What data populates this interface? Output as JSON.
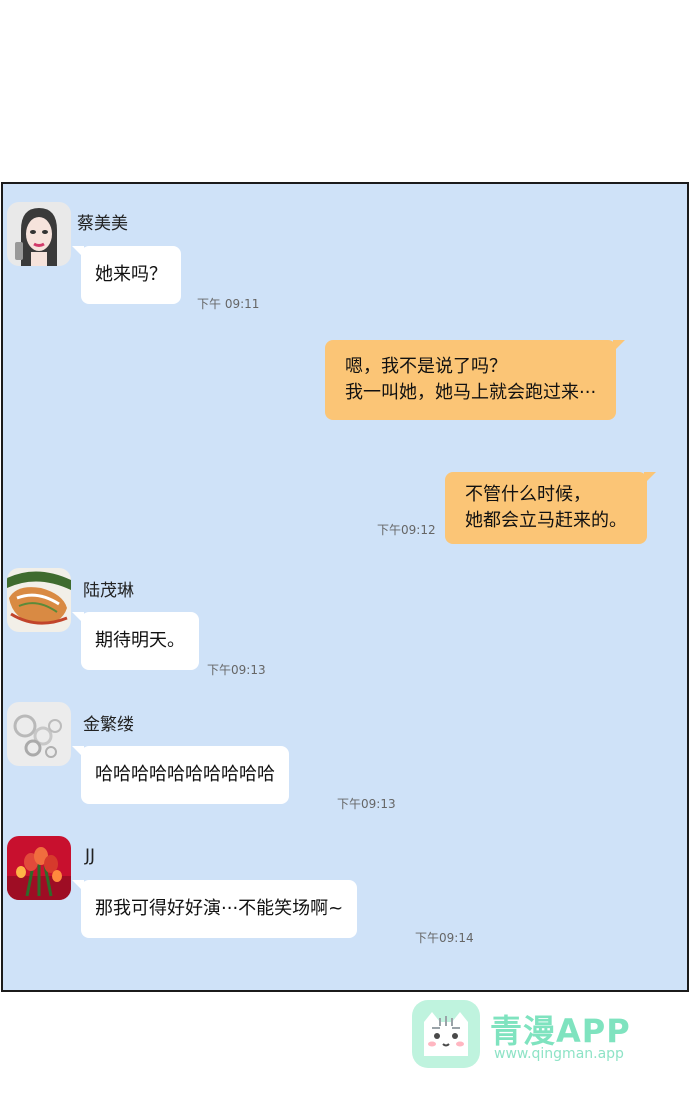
{
  "messages": [
    {
      "sender": "蔡美美",
      "avatar": "woman-avatar-icon",
      "lines": [
        "她来吗？"
      ],
      "time": "下午 09:11"
    },
    {
      "sender": "",
      "avatar": "",
      "lines": [
        "嗯，我不是说了吗？",
        "我一叫她，她马上就会跑过来···"
      ],
      "time": ""
    },
    {
      "sender": "",
      "avatar": "",
      "lines": [
        "不管什么时候，",
        "她都会立马赶来的。"
      ],
      "time": "下午09:12"
    },
    {
      "sender": "陆茂琳",
      "avatar": "food-avatar-icon",
      "lines": [
        "期待明天。"
      ],
      "time": "下午09:13"
    },
    {
      "sender": "金繁缕",
      "avatar": "rings-avatar-icon",
      "lines": [
        "哈哈哈哈哈哈哈哈哈哈"
      ],
      "time": "下午09:13"
    },
    {
      "sender": "JJ",
      "avatar": "flowers-avatar-icon",
      "lines": [
        "那我可得好好演···不能笑场啊~"
      ],
      "time": "下午09:14"
    }
  ],
  "watermark": {
    "title": "青漫APP",
    "url": "www.qingman.app",
    "icon": "cat-logo-icon"
  },
  "colors": {
    "chat_background": "#cfe2f8",
    "incoming_bubble": "#ffffff",
    "outgoing_bubble": "#fbc576",
    "watermark": "#7fe3bf"
  }
}
